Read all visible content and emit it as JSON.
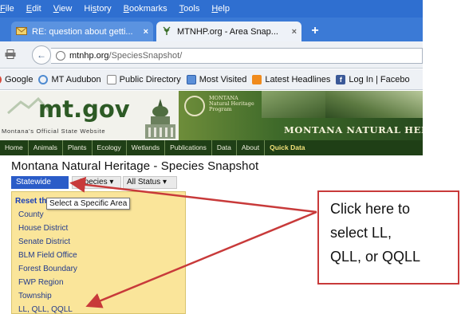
{
  "browser": {
    "menu": [
      {
        "pre": "",
        "u": "F",
        "post": "ile"
      },
      {
        "pre": "",
        "u": "E",
        "post": "dit"
      },
      {
        "pre": "",
        "u": "V",
        "post": "iew"
      },
      {
        "pre": "Hi",
        "u": "s",
        "post": "tory"
      },
      {
        "pre": "",
        "u": "B",
        "post": "ookmarks"
      },
      {
        "pre": "",
        "u": "T",
        "post": "ools"
      },
      {
        "pre": "",
        "u": "H",
        "post": "elp"
      }
    ],
    "tabs": [
      {
        "label": "RE: question about getti...",
        "icon": "envelope-icon"
      },
      {
        "label": "MTNHP.org - Area Snap...",
        "icon": "plant-icon"
      }
    ],
    "url_host": "mtnhp.org",
    "url_path": "/SpeciesSnapshot/",
    "bookmarks": [
      {
        "label": "Google",
        "icon": "google-icon"
      },
      {
        "label": "MT Audubon",
        "icon": "bird-icon"
      },
      {
        "label": "Public Directory",
        "icon": "page-icon"
      },
      {
        "label": "Most Visited",
        "icon": "most-visited-icon"
      },
      {
        "label": "Latest Headlines",
        "icon": "rss-icon"
      },
      {
        "label": "Log In | Facebo",
        "icon": "facebook-icon"
      }
    ]
  },
  "site": {
    "logo": "mt.gov",
    "tagline": "Montana's Official State Website",
    "program_badge": "MONTANA Natural Heritage Program",
    "name": "MONTANA NATURAL HERITAG",
    "nav": [
      "Home",
      "Animals",
      "Plants",
      "Ecology",
      "Wetlands",
      "Publications",
      "Data",
      "About",
      "Quick Data"
    ]
  },
  "page": {
    "title": "Montana Natural Heritage - Species Snapshot",
    "filters": {
      "area": "Statewide",
      "species": "Species ▾",
      "status": "All Status ▾"
    },
    "dropdown": {
      "reset": "Reset th",
      "tooltip": "Select a Specific Area",
      "options": [
        "County",
        "House District",
        "Senate District",
        "BLM Field Office",
        "Forest Boundary",
        "FWP Region",
        "Township",
        "LL, QLL, QQLL"
      ]
    }
  },
  "annotation": {
    "lines": [
      "Click here to",
      "select LL,",
      "QLL, or QQLL"
    ],
    "color": "#c83a3a"
  }
}
